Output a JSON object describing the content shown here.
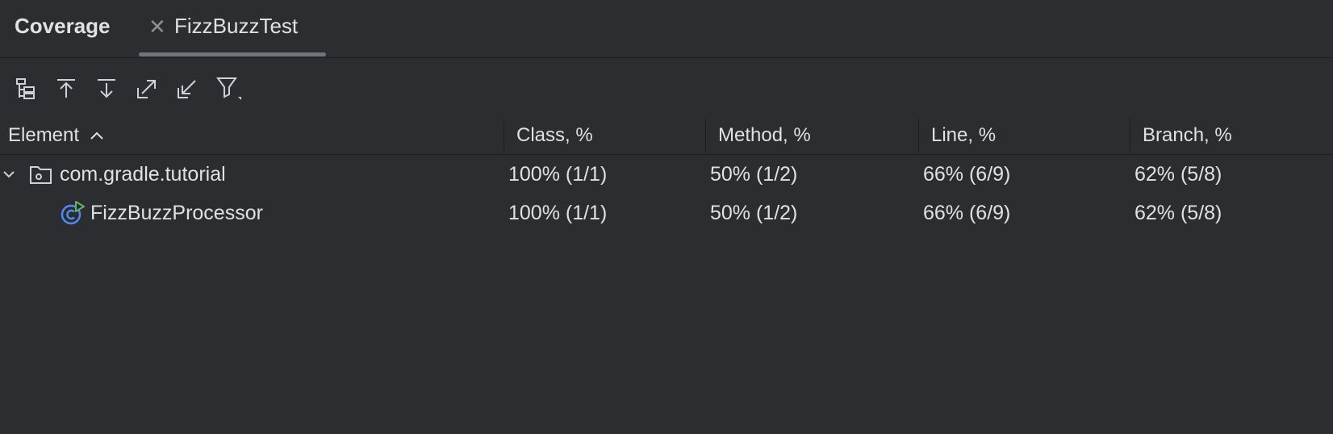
{
  "panel": {
    "title": "Coverage",
    "tab": {
      "label": "FizzBuzzTest",
      "close_icon": "close-icon"
    }
  },
  "toolbar": {
    "buttons": [
      {
        "name": "flatten-packages-button",
        "icon": "flatten-packages-icon"
      },
      {
        "name": "navigate-source-button",
        "icon": "arrow-up-to-line-icon"
      },
      {
        "name": "scroll-from-source-button",
        "icon": "arrow-down-to-line-icon"
      },
      {
        "name": "expand-all-button",
        "icon": "arrow-up-right-icon"
      },
      {
        "name": "collapse-all-button",
        "icon": "arrow-down-left-icon"
      },
      {
        "name": "filter-button",
        "icon": "filter-icon"
      }
    ]
  },
  "table": {
    "columns": [
      "Element",
      "Class, %",
      "Method, %",
      "Line, %",
      "Branch, %"
    ],
    "sort": {
      "column": "Element",
      "direction": "ascending"
    },
    "rows": [
      {
        "name": "com.gradle.tutorial",
        "kind": "package",
        "expanded": true,
        "class": "100% (1/1)",
        "method": "50% (1/2)",
        "line": "66% (6/9)",
        "branch": "62% (5/8)"
      },
      {
        "name": "FizzBuzzProcessor",
        "kind": "class",
        "class": "100% (1/1)",
        "method": "50% (1/2)",
        "line": "66% (6/9)",
        "branch": "62% (5/8)"
      }
    ]
  },
  "colors": {
    "background": "#2b2d30",
    "text": "#dfe1e5",
    "icon": "#ced0d6",
    "class_icon_blue": "#548af7",
    "run_badge_green": "#5fb865"
  }
}
